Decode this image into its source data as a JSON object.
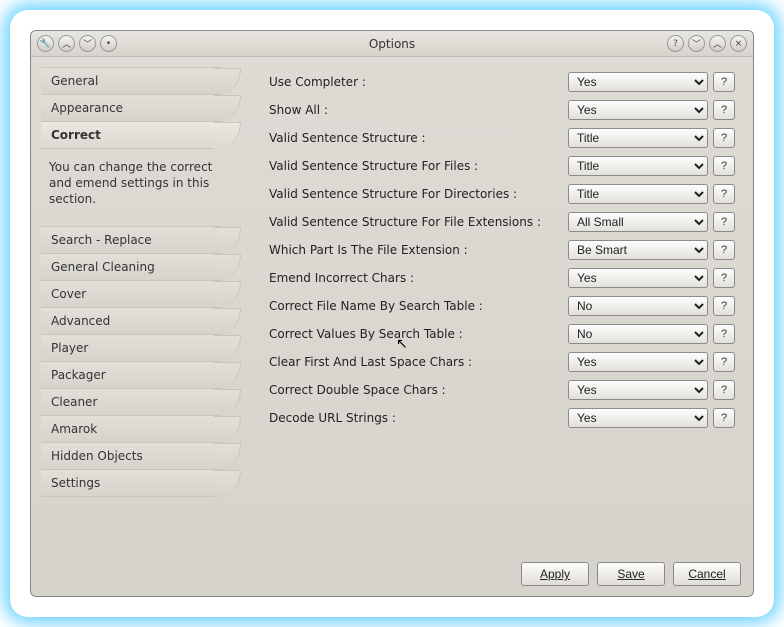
{
  "title": "Options",
  "toolbar_left_icons": [
    "wrench-icon",
    "chevron-up-icon",
    "chevron-down-icon",
    "dot-icon"
  ],
  "toolbar_right_icons": [
    "help-icon",
    "chevron-down-icon",
    "chevron-up-icon",
    "close-icon"
  ],
  "sidebar": {
    "top": [
      {
        "label": "General"
      },
      {
        "label": "Appearance"
      },
      {
        "label": "Correct",
        "selected": true
      }
    ],
    "description": "You can change the correct and emend settings in this section.",
    "bottom": [
      {
        "label": "Search - Replace"
      },
      {
        "label": "General Cleaning"
      },
      {
        "label": "Cover"
      },
      {
        "label": "Advanced"
      },
      {
        "label": "Player"
      },
      {
        "label": "Packager"
      },
      {
        "label": "Cleaner"
      },
      {
        "label": "Amarok"
      },
      {
        "label": "Hidden Objects"
      },
      {
        "label": "Settings"
      }
    ]
  },
  "settings": [
    {
      "label": "Use Completer :",
      "value": "Yes"
    },
    {
      "label": "Show All :",
      "value": "Yes"
    },
    {
      "label": "Valid Sentence Structure :",
      "value": "Title"
    },
    {
      "label": "Valid Sentence Structure For Files :",
      "value": "Title"
    },
    {
      "label": "Valid Sentence Structure For Directories :",
      "value": "Title"
    },
    {
      "label": "Valid Sentence Structure For File Extensions :",
      "value": "All Small"
    },
    {
      "label": "Which Part Is The File Extension :",
      "value": "Be Smart"
    },
    {
      "label": "Emend Incorrect Chars :",
      "value": "Yes"
    },
    {
      "label": "Correct File Name By Search Table :",
      "value": "No"
    },
    {
      "label": "Correct Values By Search Table :",
      "value": "No"
    },
    {
      "label": "Clear First And Last Space Chars :",
      "value": "Yes"
    },
    {
      "label": "Correct Double Space Chars :",
      "value": "Yes"
    },
    {
      "label": "Decode URL Strings :",
      "value": "Yes"
    }
  ],
  "help_glyph": "?",
  "footer": {
    "apply": "Apply",
    "save": "Save",
    "cancel": "Cancel"
  },
  "glyphs": {
    "wrench-icon": "🔧",
    "chevron-up-icon": "︿",
    "chevron-down-icon": "﹀",
    "dot-icon": "•",
    "help-icon": "?",
    "close-icon": "×"
  }
}
